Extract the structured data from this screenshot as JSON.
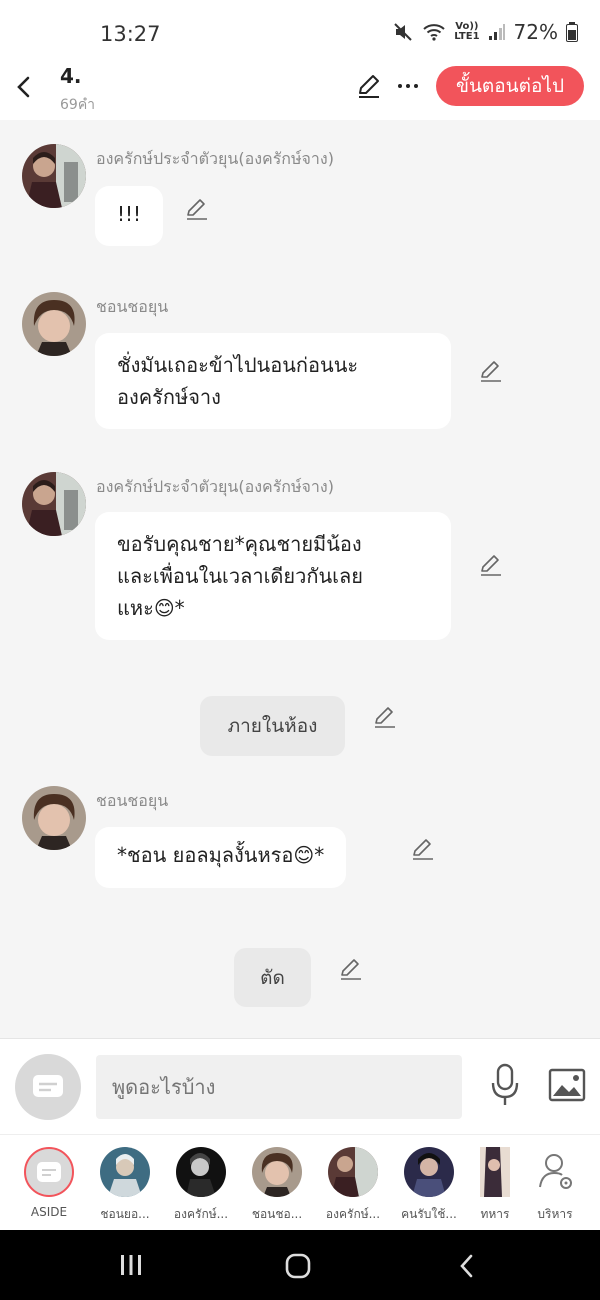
{
  "status": {
    "time": "13:27",
    "net_top": "Vo))",
    "net_bottom": "LTE1",
    "battery": "72%"
  },
  "header": {
    "title": "4.",
    "word_count": "69คำ",
    "next_label": "ขั้นตอนต่อไป"
  },
  "messages": [
    {
      "speaker": "องครักษ์ประจำตัวยุน(องครักษ์จาง)",
      "text": "!!!"
    },
    {
      "speaker": "ชอนชอยุน",
      "line1": "ชั่งมันเถอะข้าไปนอนก่อนนะ",
      "line2": "องครักษ์จาง"
    },
    {
      "speaker": "องครักษ์ประจำตัวยุน(องครักษ์จาง)",
      "line1": "ขอรับคุณชาย*คุณชายมีน้อง",
      "line2": "และเพื่อนในเวลาเดียวกันเลย",
      "line3": "แหะ😊*"
    },
    {
      "narration": "ภายในห้อง"
    },
    {
      "speaker": "ชอนชอยุน",
      "text": "*ชอน  ยอลมุลงั้นหรอ😊*"
    },
    {
      "narration": "ตัด"
    }
  ],
  "input": {
    "placeholder": "พูดอะไรบ้าง"
  },
  "characters": [
    {
      "label": "ASIDE"
    },
    {
      "label": "ชอนยอ..."
    },
    {
      "label": "องครักษ์..."
    },
    {
      "label": "ชอนชอ..."
    },
    {
      "label": "องครักษ์..."
    },
    {
      "label": "คนรับใช้..."
    },
    {
      "label": "ทหาร"
    },
    {
      "label": "บริหาร"
    }
  ],
  "colors": {
    "accent": "#f2545b",
    "background": "#f5f5f5"
  }
}
